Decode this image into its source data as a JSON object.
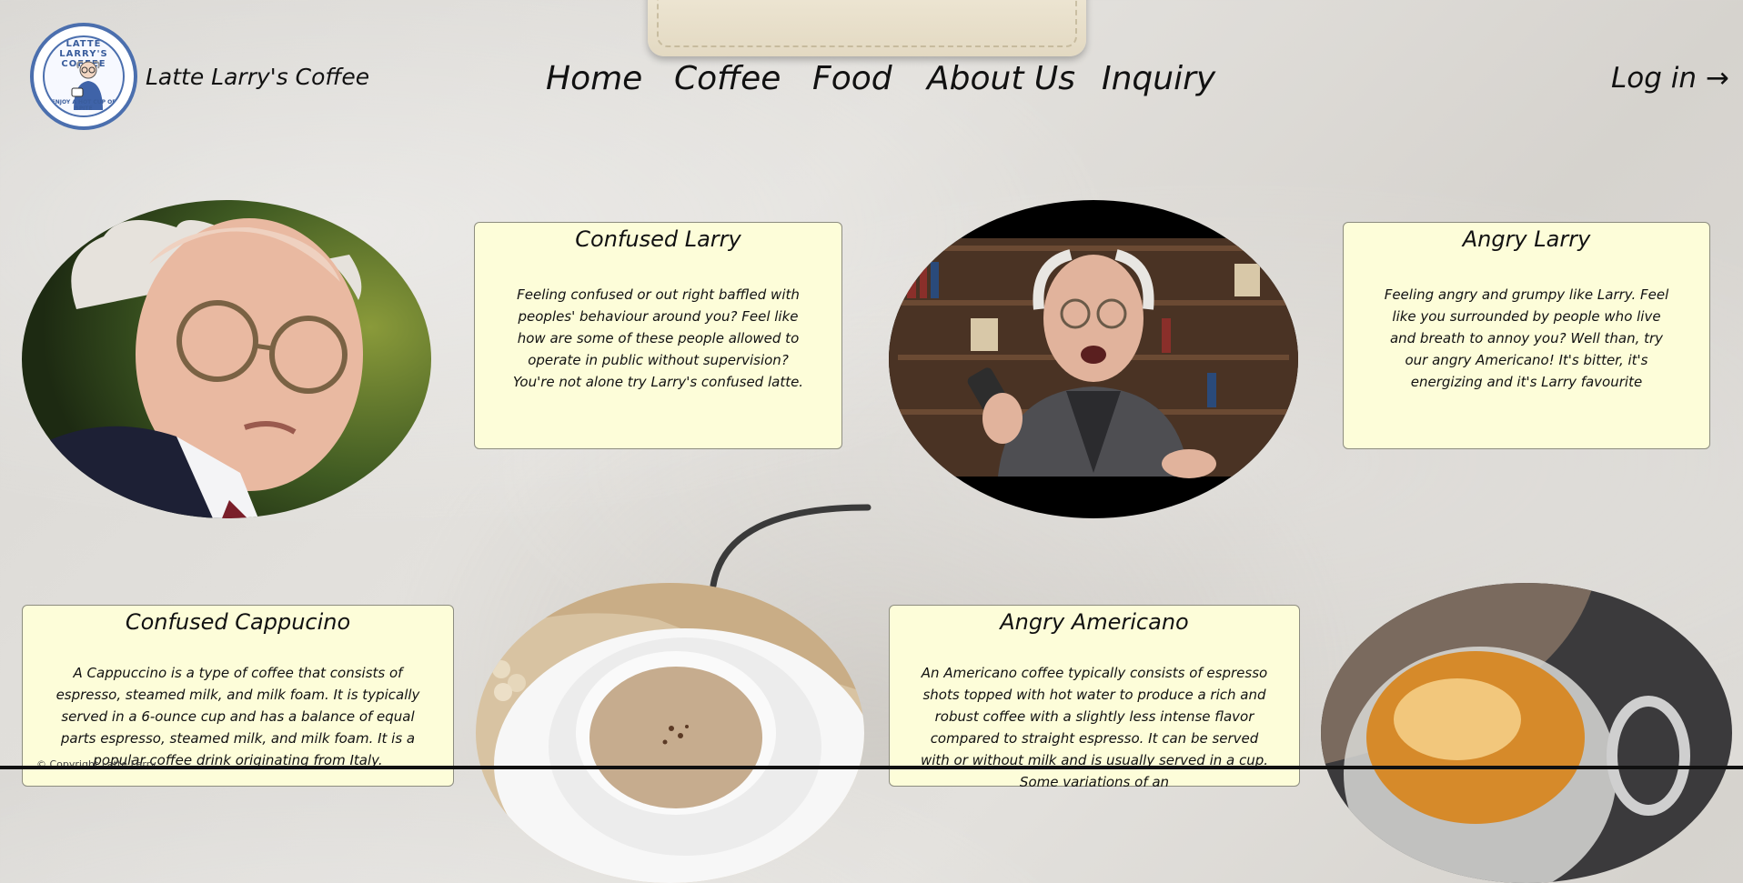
{
  "header": {
    "logo": {
      "ring_top": "LATTE LARRY'S COFFEE",
      "ring_bottom": "ENJOY A HOT CUP OF SPITE"
    },
    "brand": "Latte Larry's Coffee",
    "nav": [
      "Home",
      "Coffee",
      "Food",
      "About Us",
      "Inquiry"
    ],
    "login": "Log in →"
  },
  "cards": {
    "confused_larry": {
      "title": "Confused Larry",
      "text": "Feeling confused or out right baffled with peoples' behaviour around you? Feel like how are some of these people allowed to operate in public without supervision? You're not alone try Larry's confused latte."
    },
    "angry_larry": {
      "title": "Angry Larry",
      "text": "Feeling angry and grumpy like Larry. Feel like you surrounded by people who live and breath to annoy you? Well than, try our angry Americano! It's bitter, it's energizing and it's Larry favourite"
    },
    "confused_cappucino": {
      "title": "Confused Cappucino",
      "text": "A Cappuccino is a type of coffee that consists of espresso, steamed milk, and milk foam. It is typically served in a 6-ounce cup and has a balance of equal parts espresso, steamed milk, and milk foam. It is a popular coffee drink originating from Italy."
    },
    "angry_americano": {
      "title": "Angry Americano",
      "text": "An Americano coffee typically consists of espresso shots topped with hot water to produce a rich and robust coffee with a slightly less intense flavor compared to straight espresso. It can be served with or without milk and is usually served in a cup. Some variations of an"
    }
  },
  "footer": {
    "text": "© Copyright Latte Larry"
  },
  "colors": {
    "card_bg": "#fdfdd9",
    "logo_blue": "#4b6fae",
    "page_bg": "#dcdad6"
  }
}
